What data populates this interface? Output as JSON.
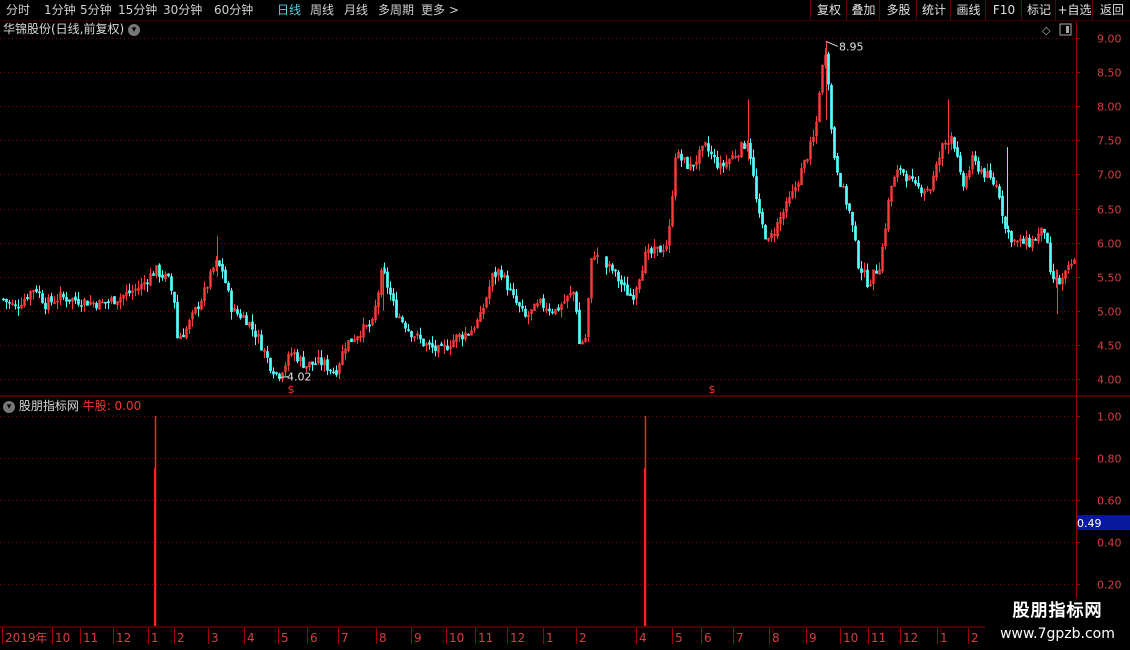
{
  "toolbar": {
    "periods": [
      {
        "label": "分时",
        "active": false
      },
      {
        "label": "1分钟",
        "active": false
      },
      {
        "label": "5分钟",
        "active": false
      },
      {
        "label": "15分钟",
        "active": false
      },
      {
        "label": "30分钟",
        "active": false
      },
      {
        "label": "60分钟",
        "active": false
      },
      {
        "label": "日线",
        "active": true
      },
      {
        "label": "周线",
        "active": false
      },
      {
        "label": "月线",
        "active": false
      },
      {
        "label": "多周期",
        "active": false
      },
      {
        "label": "更多 >",
        "active": false
      }
    ],
    "actions": [
      "复权",
      "叠加",
      "多股",
      "统计",
      "画线",
      "F10",
      "标记",
      "+自选",
      "返回"
    ]
  },
  "price_panel": {
    "title": "华锦股份(日线,前复权)",
    "high_marker": "8.95",
    "low_marker": "4.02"
  },
  "indicator_panel": {
    "name": "股朋指标网",
    "series_label": "牛股",
    "series_value": "0.00",
    "cursor_value": "0.49"
  },
  "colors": {
    "up": "#ff3c3c",
    "down": "#54ffff",
    "grid": "#8a0000",
    "axis_text": "#d04040",
    "indicator": "#ff2020",
    "cursor_bg": "#0a1aa0"
  },
  "chart_data": [
    {
      "type": "candlestick",
      "title": "华锦股份(日线,前复权)",
      "ylim": [
        3.7,
        9.25
      ],
      "y_ticks": [
        9.0,
        8.5,
        8.0,
        7.5,
        7.0,
        6.5,
        6.0,
        5.5,
        5.0,
        4.5,
        4.0
      ],
      "y_tick_labels": [
        "9.00",
        "8.50",
        "8.00",
        "7.50",
        "7.00",
        "6.50",
        "6.00",
        "5.50",
        "5.00",
        "4.50",
        "4.00"
      ],
      "annotations": [
        {
          "label": "8.95",
          "type": "high"
        },
        {
          "label": "4.02",
          "type": "low"
        }
      ],
      "signal_markers": [
        "$",
        "$"
      ],
      "close_path": [
        [
          0,
          5.2
        ],
        [
          15,
          5.05
        ],
        [
          25,
          5.2
        ],
        [
          35,
          5.35
        ],
        [
          45,
          5.1
        ],
        [
          60,
          5.2
        ],
        [
          80,
          5.15
        ],
        [
          100,
          5.1
        ],
        [
          120,
          5.2
        ],
        [
          140,
          5.35
        ],
        [
          155,
          5.6
        ],
        [
          168,
          5.45
        ],
        [
          175,
          5.1
        ],
        [
          176,
          4.6
        ],
        [
          185,
          4.7
        ],
        [
          195,
          5.0
        ],
        [
          205,
          5.3
        ],
        [
          215,
          5.7
        ],
        [
          222,
          5.6
        ],
        [
          232,
          5.0
        ],
        [
          245,
          4.9
        ],
        [
          258,
          4.6
        ],
        [
          270,
          4.2
        ],
        [
          278,
          4.05
        ],
        [
          292,
          4.4
        ],
        [
          305,
          4.2
        ],
        [
          320,
          4.25
        ],
        [
          335,
          4.1
        ],
        [
          345,
          4.5
        ],
        [
          360,
          4.7
        ],
        [
          372,
          4.8
        ],
        [
          382,
          5.6
        ],
        [
          395,
          5.0
        ],
        [
          410,
          4.7
        ],
        [
          425,
          4.5
        ],
        [
          440,
          4.4
        ],
        [
          455,
          4.6
        ],
        [
          470,
          4.7
        ],
        [
          480,
          4.9
        ],
        [
          492,
          5.5
        ],
        [
          500,
          5.6
        ],
        [
          512,
          5.2
        ],
        [
          525,
          4.9
        ],
        [
          540,
          5.1
        ],
        [
          555,
          5.0
        ],
        [
          568,
          5.2
        ],
        [
          575,
          5.3
        ],
        [
          578,
          4.5
        ],
        [
          585,
          4.6
        ],
        [
          592,
          5.9
        ],
        [
          600,
          5.7
        ],
        [
          612,
          5.6
        ],
        [
          625,
          5.3
        ],
        [
          632,
          5.2
        ],
        [
          645,
          5.8
        ],
        [
          660,
          5.9
        ],
        [
          668,
          6.0
        ],
        [
          675,
          7.3
        ],
        [
          690,
          7.1
        ],
        [
          705,
          7.4
        ],
        [
          720,
          7.1
        ],
        [
          735,
          7.3
        ],
        [
          748,
          7.5
        ],
        [
          758,
          6.4
        ],
        [
          768,
          6.0
        ],
        [
          778,
          6.3
        ],
        [
          792,
          6.7
        ],
        [
          805,
          7.2
        ],
        [
          815,
          7.6
        ],
        [
          820,
          8.4
        ],
        [
          826,
          8.9
        ],
        [
          832,
          7.4
        ],
        [
          840,
          6.9
        ],
        [
          850,
          6.4
        ],
        [
          858,
          5.7
        ],
        [
          868,
          5.4
        ],
        [
          880,
          5.7
        ],
        [
          890,
          6.8
        ],
        [
          900,
          7.1
        ],
        [
          915,
          6.8
        ],
        [
          930,
          6.8
        ],
        [
          942,
          7.4
        ],
        [
          952,
          7.6
        ],
        [
          962,
          6.8
        ],
        [
          972,
          7.2
        ],
        [
          985,
          7.0
        ],
        [
          998,
          6.8
        ],
        [
          1005,
          6.2
        ],
        [
          1015,
          6.0
        ],
        [
          1030,
          6.0
        ],
        [
          1045,
          6.2
        ],
        [
          1050,
          5.5
        ],
        [
          1060,
          5.4
        ],
        [
          1072,
          5.7
        ]
      ]
    },
    {
      "type": "bar",
      "series": [
        {
          "name": "牛股",
          "spikes": [
            {
              "x_label": "1",
              "value": 1.0
            },
            {
              "x_label": "4",
              "value": 1.0
            }
          ]
        }
      ],
      "ylim": [
        0.1,
        1.05
      ],
      "y_ticks": [
        1.0,
        0.8,
        0.6,
        0.4,
        0.2
      ],
      "y_tick_labels": [
        "1.00",
        "0.80",
        "0.60",
        "0.40",
        "0.20"
      ]
    }
  ],
  "x_axis": {
    "labels": [
      {
        "label": "2019年",
        "x": 2
      },
      {
        "label": "10",
        "x": 52
      },
      {
        "label": "11",
        "x": 80
      },
      {
        "label": "12",
        "x": 113
      },
      {
        "label": "1",
        "x": 148
      },
      {
        "label": "2",
        "x": 174
      },
      {
        "label": "3",
        "x": 208
      },
      {
        "label": "4",
        "x": 244
      },
      {
        "label": "5",
        "x": 278
      },
      {
        "label": "6",
        "x": 307
      },
      {
        "label": "7",
        "x": 338
      },
      {
        "label": "8",
        "x": 376
      },
      {
        "label": "9",
        "x": 411
      },
      {
        "label": "10",
        "x": 446
      },
      {
        "label": "11",
        "x": 475
      },
      {
        "label": "12",
        "x": 507
      },
      {
        "label": "1",
        "x": 543
      },
      {
        "label": "2",
        "x": 576
      },
      {
        "label": "4",
        "x": 636
      },
      {
        "label": "5",
        "x": 672
      },
      {
        "label": "6",
        "x": 701
      },
      {
        "label": "7",
        "x": 733
      },
      {
        "label": "8",
        "x": 769
      },
      {
        "label": "9",
        "x": 806
      },
      {
        "label": "10",
        "x": 840
      },
      {
        "label": "11",
        "x": 868
      },
      {
        "label": "12",
        "x": 900
      },
      {
        "label": "1",
        "x": 937
      },
      {
        "label": "2",
        "x": 968
      }
    ]
  },
  "watermark": {
    "line1": "股朋指标网",
    "line2": "www.7gpzb.com"
  }
}
